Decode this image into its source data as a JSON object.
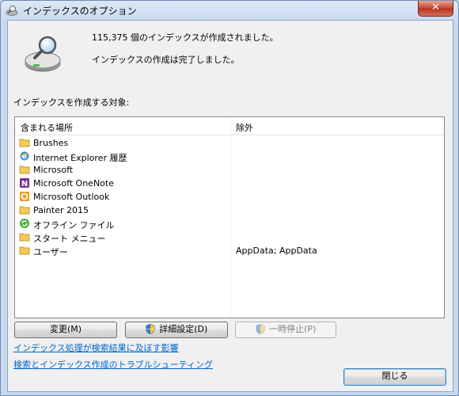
{
  "window": {
    "title": "インデックスのオプション",
    "close_glyph": "✕"
  },
  "status": {
    "line1": "115,375 個のインデックスが作成されました。",
    "line2": "インデックスの作成は完了しました。"
  },
  "section_label": "インデックスを作成する対象:",
  "list": {
    "col_included": "含まれる場所",
    "col_excluded": "除外",
    "rows": [
      {
        "label": "Brushes",
        "exclude": "",
        "icon": "folder-icon"
      },
      {
        "label": "Internet Explorer 履歴",
        "exclude": "",
        "icon": "internet-explorer-icon"
      },
      {
        "label": "Microsoft",
        "exclude": "",
        "icon": "folder-icon"
      },
      {
        "label": "Microsoft OneNote",
        "exclude": "",
        "icon": "onenote-icon"
      },
      {
        "label": "Microsoft Outlook",
        "exclude": "",
        "icon": "outlook-icon"
      },
      {
        "label": "Painter 2015",
        "exclude": "",
        "icon": "folder-icon"
      },
      {
        "label": "オフライン ファイル",
        "exclude": "",
        "icon": "sync-icon"
      },
      {
        "label": "スタート メニュー",
        "exclude": "",
        "icon": "folder-icon"
      },
      {
        "label": "ユーザー",
        "exclude": "AppData; AppData",
        "icon": "folder-icon"
      }
    ]
  },
  "buttons": {
    "change": "変更(M)",
    "advanced": "詳細設定(D)",
    "pause": "一時停止(P)",
    "close": "閉じる"
  },
  "links": {
    "affect": "インデックス処理が検索結果に及ぼす影響",
    "troubleshoot": "検索とインデックス作成のトラブルシューティング"
  }
}
